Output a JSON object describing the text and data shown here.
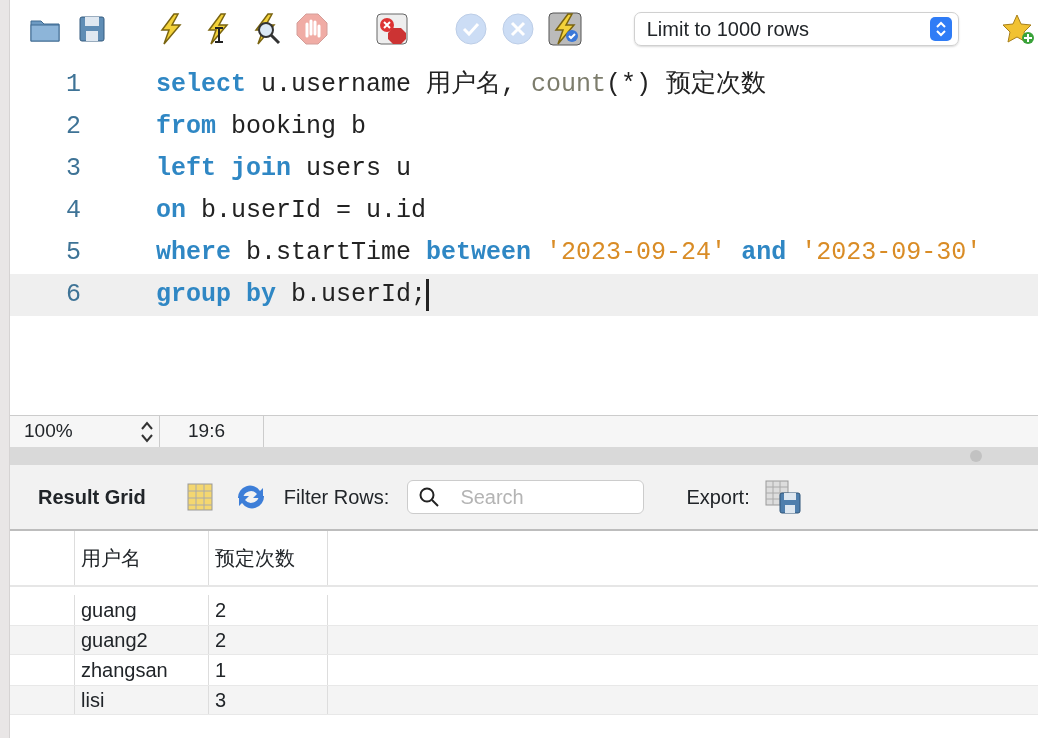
{
  "toolbar": {
    "buttons": [
      {
        "kind": "folder",
        "disabled": false
      },
      {
        "kind": "save",
        "disabled": false
      },
      {
        "kind": "bolt",
        "disabled": false
      },
      {
        "kind": "bolt-cursor",
        "disabled": false
      },
      {
        "kind": "bolt-magnifier",
        "disabled": false
      },
      {
        "kind": "stop",
        "disabled": true
      },
      {
        "kind": "error-stop",
        "disabled": false
      },
      {
        "kind": "check",
        "disabled": true
      },
      {
        "kind": "cross",
        "disabled": true
      },
      {
        "kind": "bolt-check",
        "disabled": false
      }
    ],
    "limit_select": {
      "value": "Limit to 1000 rows"
    }
  },
  "editor": {
    "lines": [
      {
        "number": "1",
        "current": false,
        "tokens": [
          {
            "kind": "keyword",
            "text": "select"
          },
          {
            "kind": "plain",
            "text": " u.username 用户名, "
          },
          {
            "kind": "function",
            "text": "count"
          },
          {
            "kind": "plain",
            "text": "(*) 预定次数"
          }
        ]
      },
      {
        "number": "2",
        "current": false,
        "tokens": [
          {
            "kind": "keyword",
            "text": "from"
          },
          {
            "kind": "plain",
            "text": " booking b"
          }
        ]
      },
      {
        "number": "3",
        "current": false,
        "tokens": [
          {
            "kind": "keyword",
            "text": "left join"
          },
          {
            "kind": "plain",
            "text": " users u"
          }
        ]
      },
      {
        "number": "4",
        "current": false,
        "tokens": [
          {
            "kind": "keyword",
            "text": "on"
          },
          {
            "kind": "plain",
            "text": " b.userId = u.id"
          }
        ]
      },
      {
        "number": "5",
        "current": false,
        "tokens": [
          {
            "kind": "keyword",
            "text": "where"
          },
          {
            "kind": "plain",
            "text": " b.startTime "
          },
          {
            "kind": "keyword",
            "text": "between"
          },
          {
            "kind": "string",
            "text": " '2023-09-24'"
          },
          {
            "kind": "keyword",
            "text": " and"
          },
          {
            "kind": "string",
            "text": " '2023-09-30'"
          }
        ]
      },
      {
        "number": "6",
        "current": true,
        "tokens": [
          {
            "kind": "keyword",
            "text": "group by"
          },
          {
            "kind": "plain",
            "text": " b.userId;"
          }
        ]
      }
    ]
  },
  "status_bar": {
    "zoom": "100%",
    "cursor_position": "19:6"
  },
  "result_toolbar": {
    "title": "Result Grid",
    "filter_label": "Filter Rows:",
    "search": {
      "placeholder": "Search"
    },
    "export_label": "Export:"
  },
  "result_grid": {
    "columns": [
      "用户名",
      "预定次数"
    ],
    "rows": [
      [
        "guang",
        "2"
      ],
      [
        "guang2",
        "2"
      ],
      [
        "zhangsan",
        "1"
      ],
      [
        "lisi",
        "3"
      ]
    ]
  }
}
